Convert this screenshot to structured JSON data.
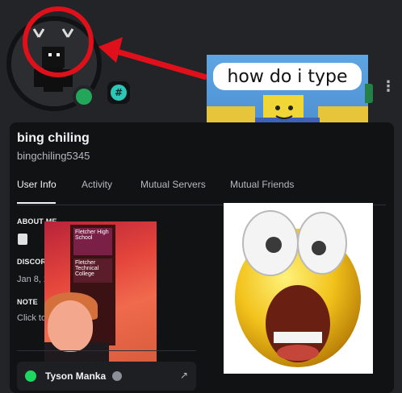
{
  "profile": {
    "display_name": "bing chiling",
    "username": "bingchiling5345"
  },
  "tabs": [
    "User Info",
    "Activity",
    "Mutual Servers",
    "Mutual Friends"
  ],
  "sections": {
    "about_me": "ABOUT ME",
    "discord_member_since_label": "DISCOR",
    "discord_member_since_value": "Jan 8, 2",
    "note_label": "NOTE",
    "note_placeholder": "Click to"
  },
  "meme": {
    "caption": "how do i type"
  },
  "badge": {
    "symbol": "#"
  },
  "photo": {
    "sign_top": "Fletcher High School",
    "sign_bottom": "Fletcher Technical College"
  },
  "spotify": {
    "name": "Tyson Manka",
    "ext_icon": "↗"
  },
  "colors": {
    "accent_red": "#e0101a",
    "online_green": "#23a55a"
  }
}
